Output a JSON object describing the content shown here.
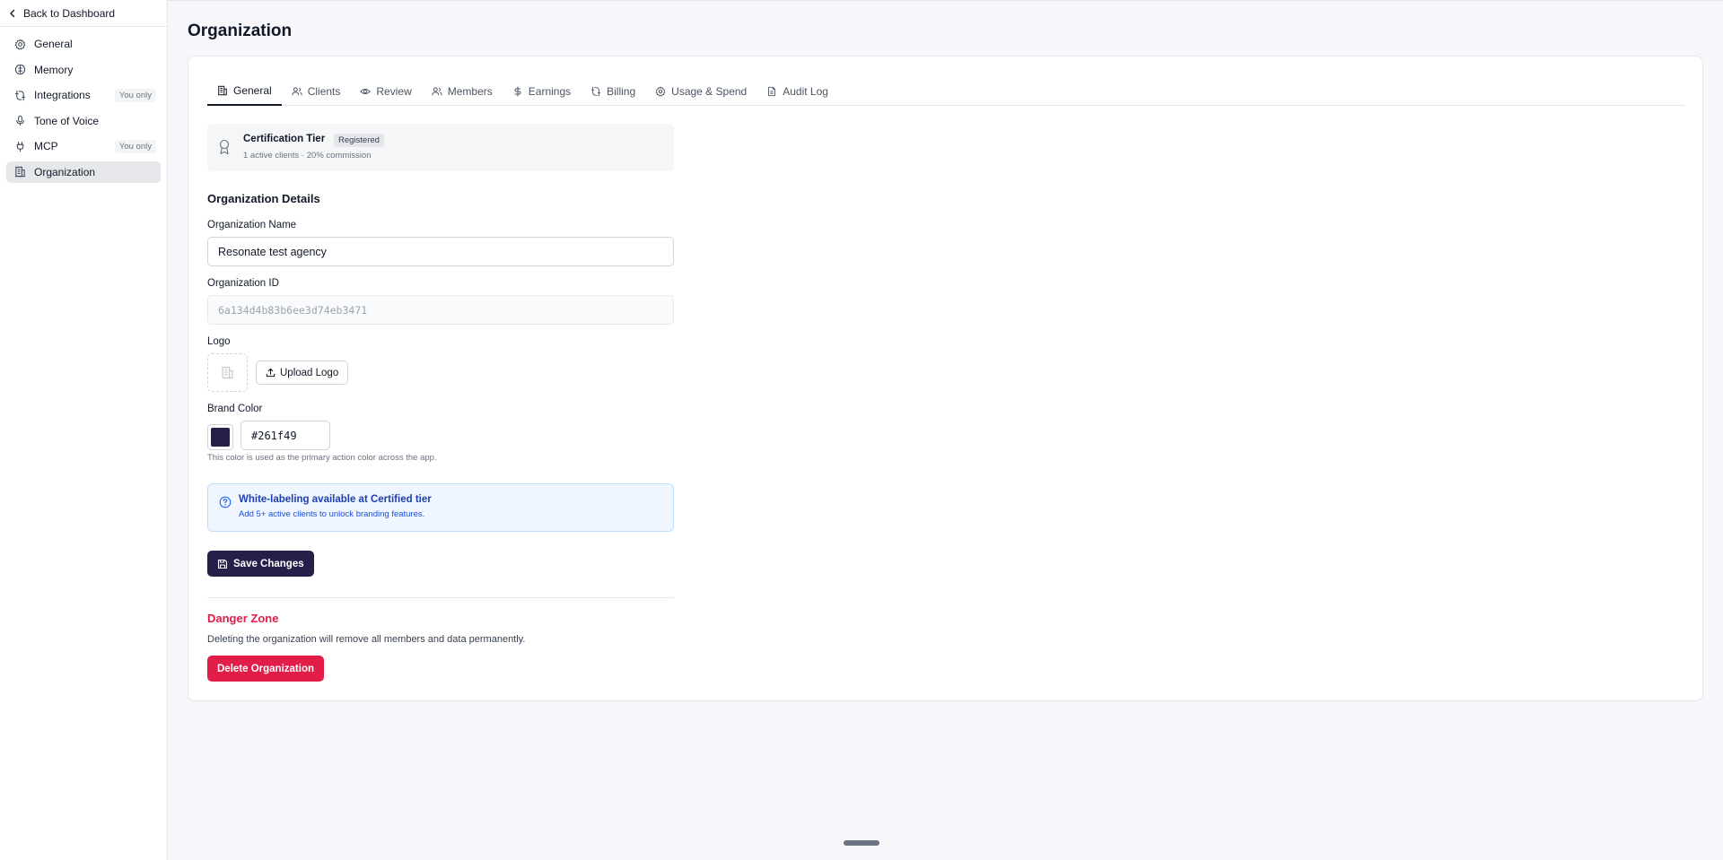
{
  "sidebar": {
    "back_label": "Back to Dashboard",
    "items": [
      {
        "label": "General",
        "icon": "gear-icon",
        "badge": ""
      },
      {
        "label": "Memory",
        "icon": "brain-icon",
        "badge": ""
      },
      {
        "label": "Integrations",
        "icon": "plug-connect-icon",
        "badge": "You only"
      },
      {
        "label": "Tone of Voice",
        "icon": "microphone-icon",
        "badge": ""
      },
      {
        "label": "MCP",
        "icon": "plug-icon",
        "badge": "You only"
      },
      {
        "label": "Organization",
        "icon": "building-icon",
        "badge": "",
        "active": true
      }
    ]
  },
  "page": {
    "title": "Organization"
  },
  "tabs": [
    {
      "label": "General",
      "icon": "building-icon",
      "active": true
    },
    {
      "label": "Clients",
      "icon": "users-icon"
    },
    {
      "label": "Review",
      "icon": "eye-icon"
    },
    {
      "label": "Members",
      "icon": "users-icon"
    },
    {
      "label": "Earnings",
      "icon": "dollar-icon"
    },
    {
      "label": "Billing",
      "icon": "plug-connect-icon"
    },
    {
      "label": "Usage & Spend",
      "icon": "gear-icon"
    },
    {
      "label": "Audit Log",
      "icon": "document-icon"
    }
  ],
  "certification": {
    "title": "Certification Tier",
    "badge": "Registered",
    "subtitle": "1 active clients · 20% commission"
  },
  "details": {
    "section_title": "Organization Details",
    "name_label": "Organization Name",
    "name_value": "Resonate test agency",
    "id_label": "Organization ID",
    "id_value": "6a134d4b83b6ee3d74eb3471",
    "logo_label": "Logo",
    "upload_label": "Upload Logo",
    "brand_color_label": "Brand Color",
    "brand_color_value": "#261f49",
    "brand_color_help": "This color is used as the primary action color across the app."
  },
  "info": {
    "title": "White-labeling available at Certified tier",
    "subtitle": "Add 5+ active clients to unlock branding features."
  },
  "save_label": "Save Changes",
  "danger": {
    "title": "Danger Zone",
    "text": "Deleting the organization will remove all members and data permanently.",
    "delete_label": "Delete Organization"
  },
  "colors": {
    "accent": "#261f49",
    "danger": "#e11d48",
    "info_bg": "#eff6ff",
    "info_text": "#1e40af"
  }
}
